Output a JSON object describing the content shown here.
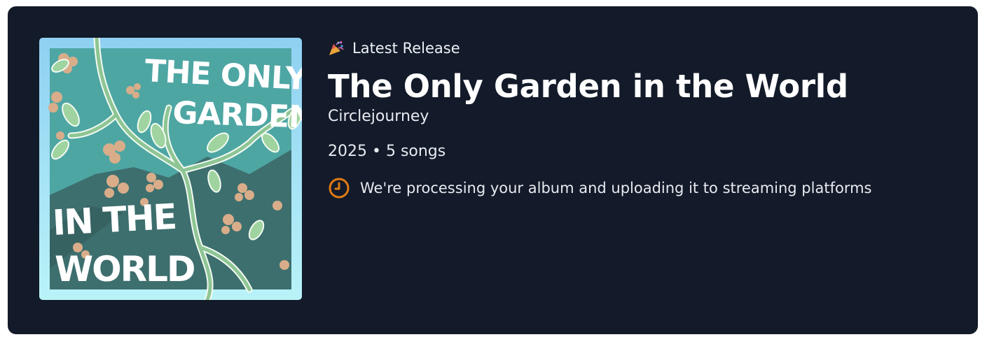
{
  "release": {
    "eyebrow_icon": "party-popper-icon",
    "eyebrow": "Latest Release",
    "title": "The Only Garden in the World",
    "artist": "Circlejourney",
    "meta": "2025 • 5 songs",
    "status_icon": "clock-icon",
    "status": "We're processing your album and uploading it to streaming platforms"
  },
  "cover": {
    "alt": "Album art",
    "lettering_top": "THE ONLY GARDEN",
    "lettering_bottom": "IN THE WORLD"
  },
  "colors": {
    "card_background": "#131a29",
    "status_accent": "#e07b12"
  }
}
